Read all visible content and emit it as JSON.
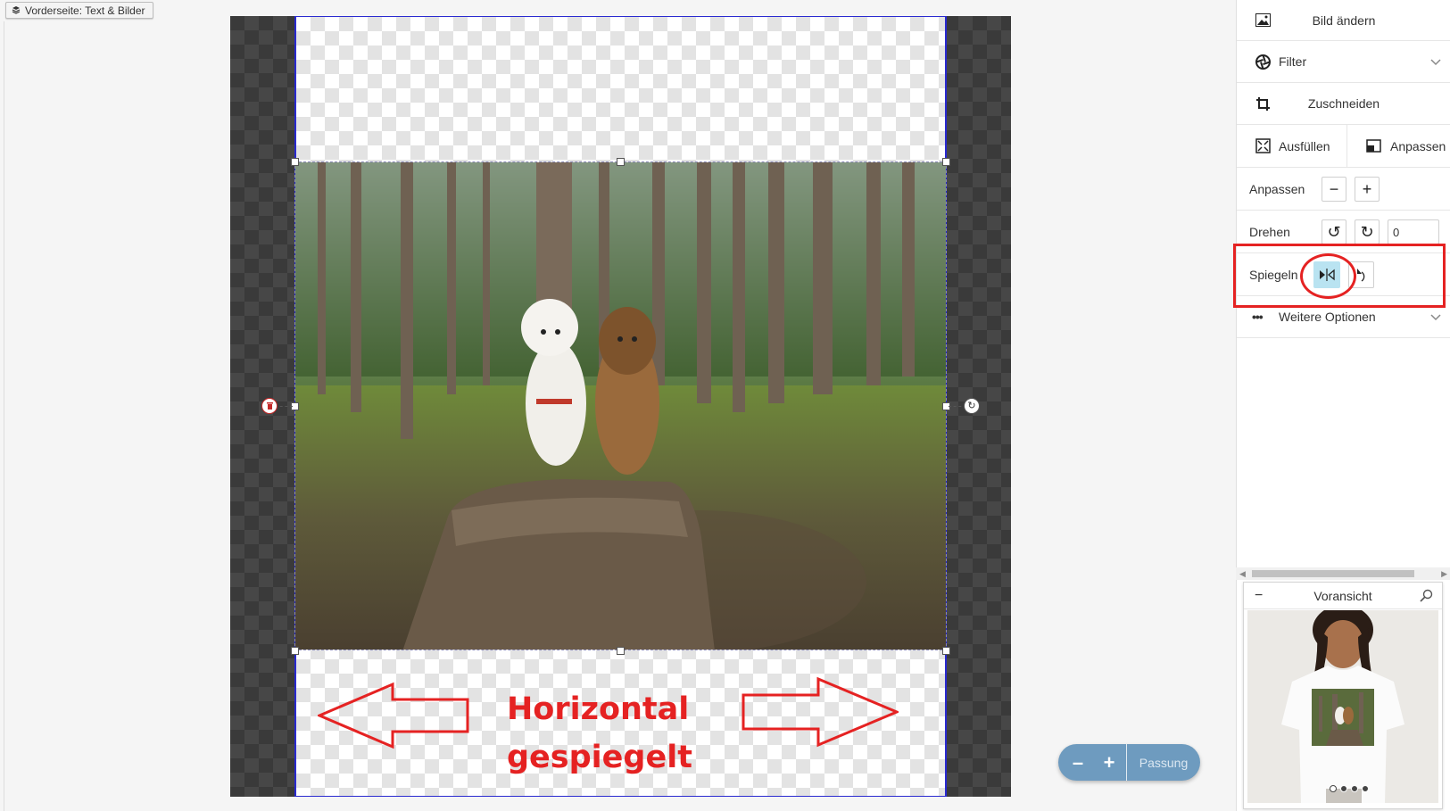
{
  "layer_badge": {
    "label": "Vorderseite: Text & Bilder",
    "icon": "layers-icon"
  },
  "annotation": {
    "line1": "Horizontal",
    "line2": "gespiegelt",
    "color": "#e52222"
  },
  "zoom": {
    "minus": "–",
    "plus": "+",
    "fit_label": "Passung"
  },
  "panel": {
    "change_image": {
      "label": "Bild ändern",
      "icon": "image-icon"
    },
    "filter": {
      "label": "Filter",
      "icon": "aperture-icon"
    },
    "crop": {
      "label": "Zuschneiden",
      "icon": "crop-icon"
    },
    "fill": {
      "label": "Ausfüllen",
      "icon": "expand-icon"
    },
    "fit": {
      "label": "Anpassen",
      "icon": "fit-icon"
    },
    "scale": {
      "label": "Anpassen",
      "minus": "−",
      "plus": "+"
    },
    "rotate": {
      "label": "Drehen",
      "value": "0"
    },
    "mirror": {
      "label": "Spiegeln"
    },
    "more": {
      "label": "Weitere Optionen",
      "icon": "ellipsis-icon"
    }
  },
  "preview": {
    "title": "Voransicht",
    "collapse": "−",
    "pages": 4,
    "active_page": 1
  },
  "colors": {
    "accent": "#6e9bbf",
    "highlight": "#e52222",
    "active_button": "#b9e3f1"
  }
}
